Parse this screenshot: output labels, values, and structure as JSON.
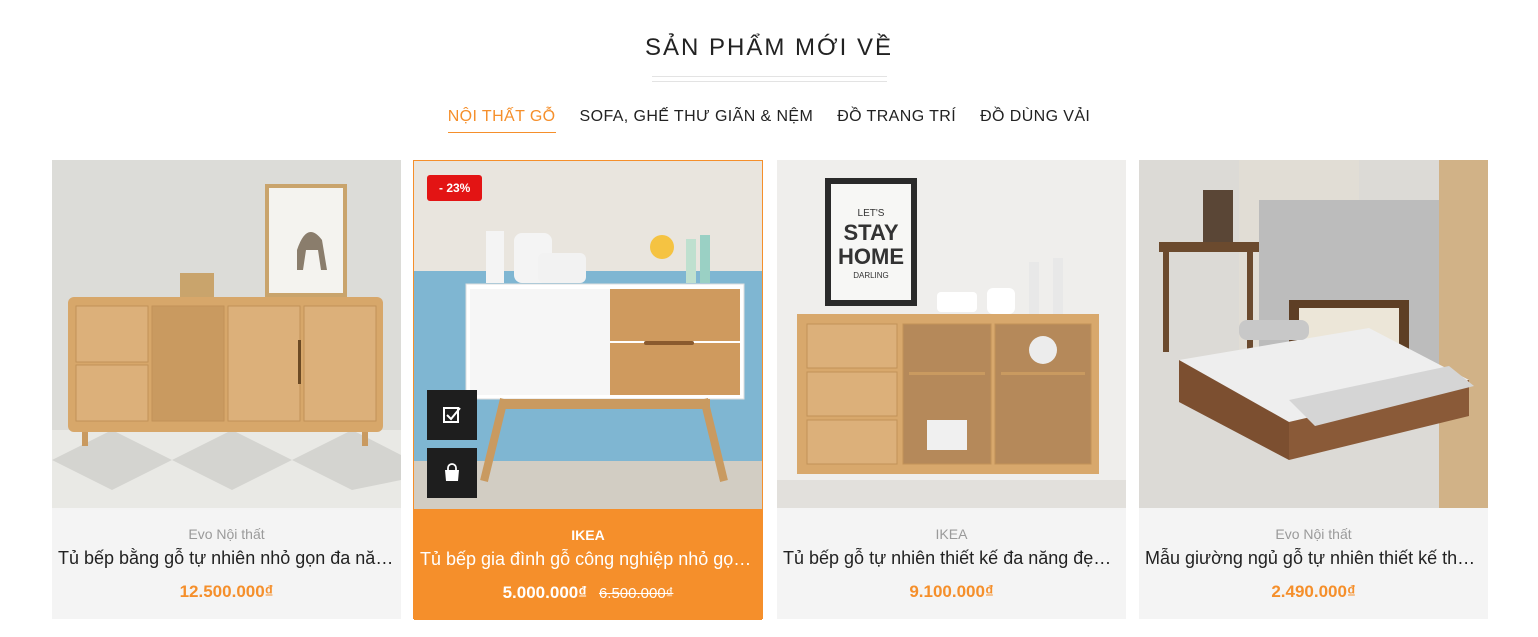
{
  "section": {
    "title": "SẢN PHẨM MỚI VỀ"
  },
  "tabs": [
    {
      "label": "NỘI THẤT GỖ",
      "active": true
    },
    {
      "label": "SOFA, GHẾ THƯ GIÃN & NỆM",
      "active": false
    },
    {
      "label": "ĐỒ TRANG TRÍ",
      "active": false
    },
    {
      "label": "ĐỒ DÙNG VẢI",
      "active": false
    }
  ],
  "products": [
    {
      "brand": "Evo Nội thất",
      "name": "Tủ bếp bằng gỗ tự nhiên nhỏ gọn đa năng hiện đại",
      "price": "12.500.000₫"
    },
    {
      "brand": "IKEA",
      "name": "Tủ bếp gia đình gỗ công nghiệp nhỏ gọn tiện lợi",
      "price": "5.000.000₫",
      "old_price": "6.500.000₫",
      "discount": "- 23%"
    },
    {
      "brand": "IKEA",
      "name": "Tủ bếp gỗ tự nhiên thiết kế đa năng đẹp mắt",
      "price": "9.100.000₫"
    },
    {
      "brand": "Evo Nội thất",
      "name": "Mẫu giường ngủ gỗ tự nhiên thiết kế thông minh",
      "price": "2.490.000₫"
    }
  ],
  "icons": {
    "compare": "check-square-icon",
    "cart": "shopping-bag-icon"
  },
  "colors": {
    "accent": "#f58f2b",
    "badge": "#e31414",
    "action": "#1e1e1e"
  }
}
